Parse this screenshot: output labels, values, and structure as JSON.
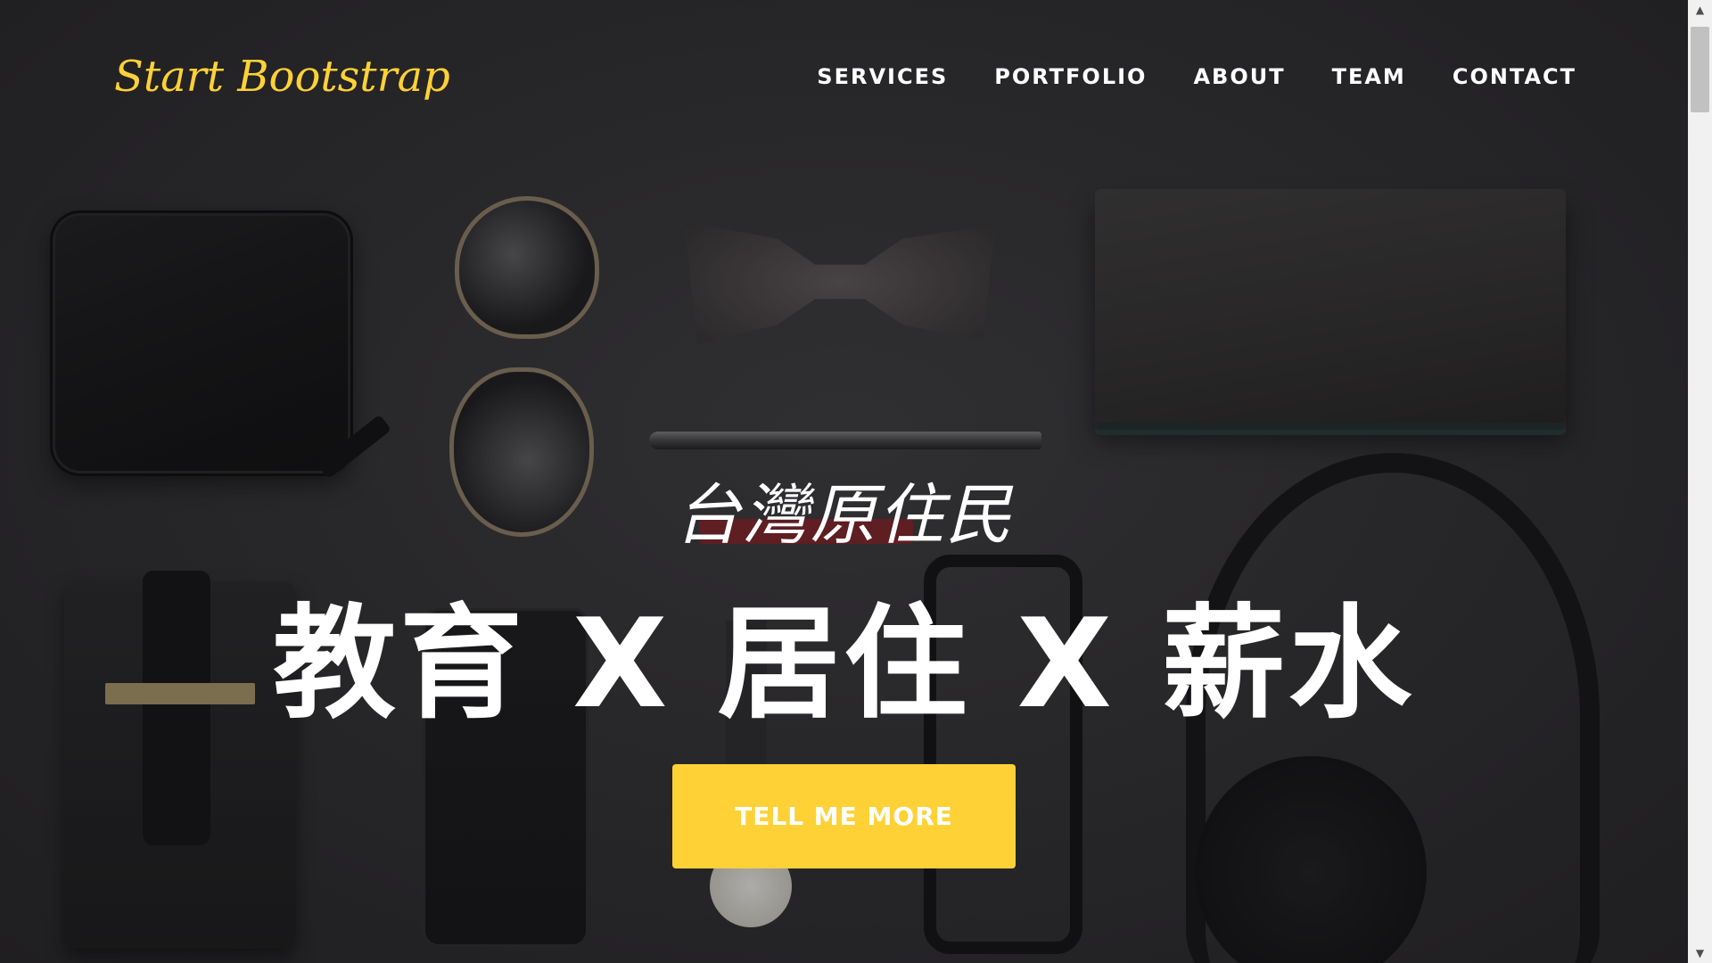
{
  "brand": {
    "label": "Start Bootstrap"
  },
  "nav": {
    "items": [
      {
        "label": "SERVICES"
      },
      {
        "label": "PORTFOLIO"
      },
      {
        "label": "ABOUT"
      },
      {
        "label": "TEAM"
      },
      {
        "label": "CONTACT"
      }
    ]
  },
  "hero": {
    "subheading": "台灣原住民",
    "heading": "教育 X 居住 X 薪水",
    "cta_label": "TELL ME MORE"
  },
  "scrollbar": {
    "up_icon": "▲",
    "down_icon": "▼"
  },
  "colors": {
    "accent": "#fed136",
    "text": "#ffffff"
  }
}
